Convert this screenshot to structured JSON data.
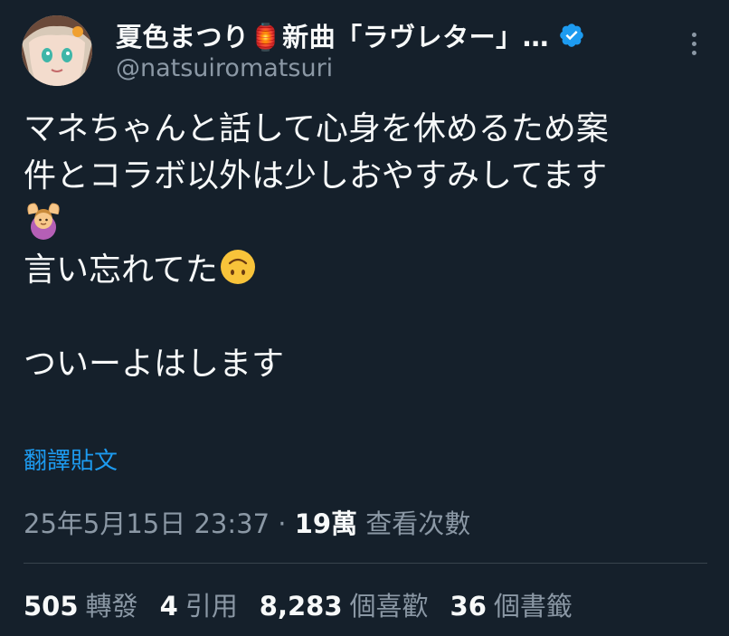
{
  "author": {
    "display_name": "夏色まつり🏮新曲「ラヴレター」…",
    "handle": "@natsuiromatsuri",
    "verified_icon": "verified-badge-icon",
    "avatar_icon": "avatar"
  },
  "tweet": {
    "lines": [
      "マネちゃんと話して心身を休めるため案",
      "件とコラボ以外は少しおやすみしてます",
      "",
      "言い忘れてた",
      "",
      "ついーよはします"
    ],
    "emojis": {
      "line3": "person-gesturing-ok-emoji",
      "line4": "upside-down-face-emoji"
    }
  },
  "translate_label": "翻譯貼文",
  "meta": {
    "timestamp": "25年5月15日 23:37",
    "separator": " · ",
    "views_count": "19萬",
    "views_label": "查看次數"
  },
  "stats": {
    "retweets": {
      "count": "505",
      "label": "轉發"
    },
    "quotes": {
      "count": "4",
      "label": "引用"
    },
    "likes": {
      "count": "8,283",
      "label": "個喜歡"
    },
    "bookmarks": {
      "count": "36",
      "label": "個書籤"
    }
  },
  "colors": {
    "background": "#15202b",
    "text_primary": "#f7f9f9",
    "text_secondary": "#8b98a5",
    "link": "#1d9bf0",
    "divider": "#38444d"
  }
}
